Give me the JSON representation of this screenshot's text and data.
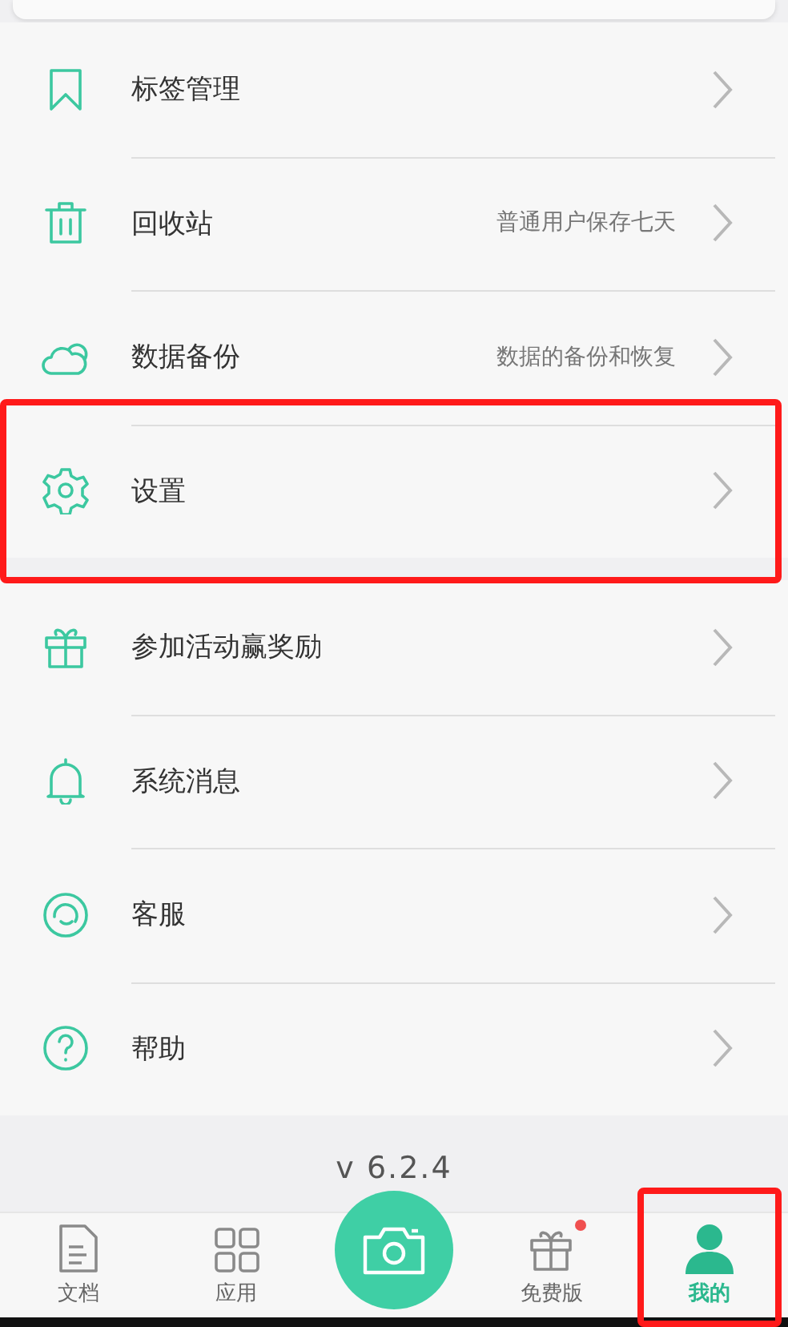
{
  "groups": [
    {
      "items": [
        {
          "label": "标签管理",
          "highlighted": false
        },
        {
          "label": "回收站",
          "hint": "普通用户保存七天",
          "highlighted": false
        },
        {
          "label": "数据备份",
          "hint": "数据的备份和恢复",
          "highlighted": false
        },
        {
          "label": "设置",
          "highlighted": true
        }
      ]
    },
    {
      "items": [
        {
          "label": "参加活动赢奖励",
          "highlighted": false
        },
        {
          "label": "系统消息",
          "highlighted": false
        },
        {
          "label": "客服",
          "highlighted": false
        },
        {
          "label": "帮助",
          "highlighted": false
        }
      ]
    }
  ],
  "version": "v 6.2.4",
  "tabs": [
    {
      "kind": "tab",
      "label": "文档",
      "selected": false,
      "badge": false,
      "highlighted": false
    },
    {
      "kind": "tab",
      "label": "应用",
      "selected": false,
      "badge": false,
      "highlighted": false
    },
    {
      "kind": "camera"
    },
    {
      "kind": "tab",
      "label": "免费版",
      "selected": false,
      "badge": true,
      "highlighted": false
    },
    {
      "kind": "tab",
      "label": "我的",
      "selected": true,
      "badge": false,
      "highlighted": true
    }
  ]
}
